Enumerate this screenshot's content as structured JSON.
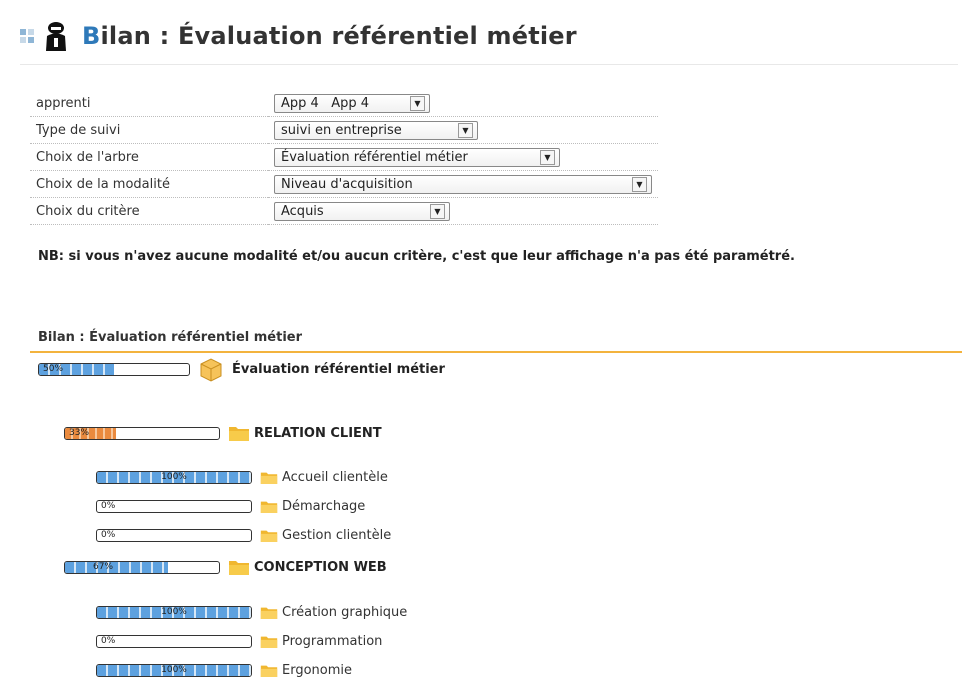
{
  "header": {
    "title_first": "B",
    "title_rest": "ilan : Évaluation référentiel métier"
  },
  "params": [
    {
      "label": "apprenti",
      "value": "App 4   App 4"
    },
    {
      "label": "Type de suivi",
      "value": "suivi en entreprise"
    },
    {
      "label": "Choix de l'arbre",
      "value": "Évaluation référentiel métier"
    },
    {
      "label": "Choix de la modalité",
      "value": "Niveau d'acquisition"
    },
    {
      "label": "Choix du critère",
      "value": "Acquis"
    }
  ],
  "note": "NB: si vous n'avez aucune modalité et/ou aucun critère, c'est que leur affichage n'a pas été paramétré.",
  "section_title": "Bilan : Évaluation référentiel métier",
  "tree": {
    "root": {
      "label": "Évaluation référentiel métier",
      "percent": 50,
      "percent_text": "50%"
    },
    "groups": [
      {
        "label": "RELATION CLIENT",
        "percent": 33,
        "percent_text": "33%",
        "color": "orange",
        "items": [
          {
            "label": "Accueil clientèle",
            "percent": 100,
            "percent_text": "100%"
          },
          {
            "label": "Démarchage",
            "percent": 0,
            "percent_text": "0%"
          },
          {
            "label": "Gestion clientèle",
            "percent": 0,
            "percent_text": "0%"
          }
        ]
      },
      {
        "label": "CONCEPTION WEB",
        "percent": 67,
        "percent_text": "67%",
        "color": "blue",
        "items": [
          {
            "label": "Création graphique",
            "percent": 100,
            "percent_text": "100%"
          },
          {
            "label": "Programmation",
            "percent": 0,
            "percent_text": "0%"
          },
          {
            "label": "Ergonomie",
            "percent": 100,
            "percent_text": "100%"
          }
        ]
      }
    ]
  },
  "colors": {
    "accent": "#2e79b9",
    "rule": "#f3b33d",
    "bar_blue": "#5da1df",
    "bar_orange": "#ea8a3e",
    "folder": "#f5c43f"
  }
}
